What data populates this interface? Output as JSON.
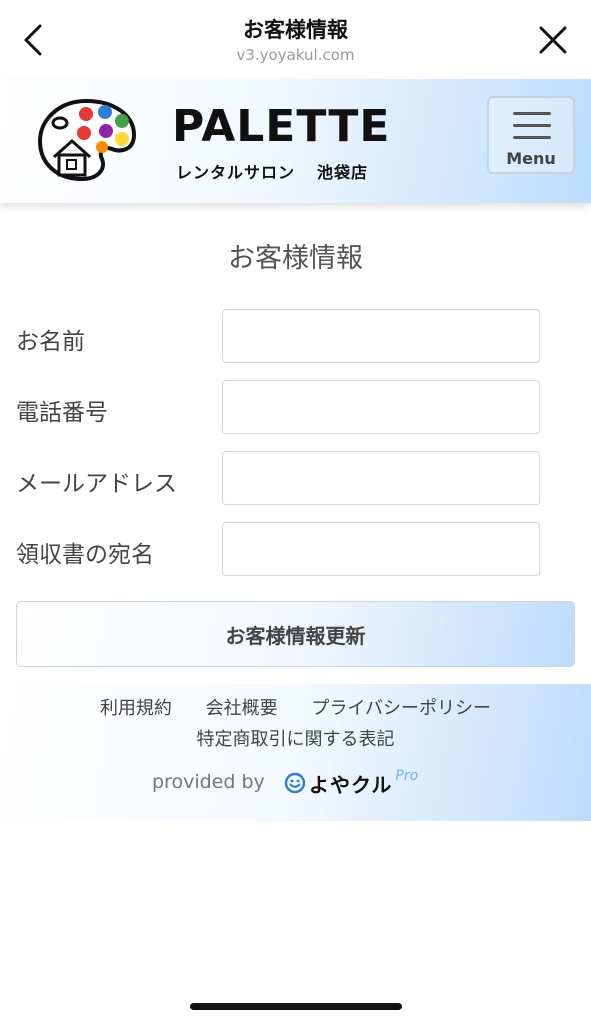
{
  "browser": {
    "title": "お客様情報",
    "url": "v3.yoyakul.com"
  },
  "header": {
    "brand_name": "PALETTE",
    "brand_sub": "レンタルサロン",
    "branch": "池袋店",
    "menu_label": "Menu"
  },
  "form": {
    "page_title": "お客様情報",
    "fields": [
      {
        "label": "お名前",
        "value": "",
        "placeholder": ""
      },
      {
        "label": "電話番号",
        "value": "",
        "placeholder": ""
      },
      {
        "label": "メールアドレス",
        "value": "",
        "placeholder": ""
      },
      {
        "label": "領収書の宛名",
        "value": "",
        "placeholder": ""
      }
    ],
    "submit_label": "お客様情報更新"
  },
  "footer": {
    "links": [
      "利用規約",
      "会社概要",
      "プライバシーポリシー",
      "特定商取引に関する表記"
    ],
    "provided_by": "provided by",
    "service_name": "よやクル",
    "service_suffix": "Pro"
  },
  "colors": {
    "accent_blue": "#bcdcfb",
    "palette_dots": [
      "#e53935",
      "#2e7dd7",
      "#43a047",
      "#fdd835",
      "#fb8c00",
      "#8e24aa"
    ]
  }
}
